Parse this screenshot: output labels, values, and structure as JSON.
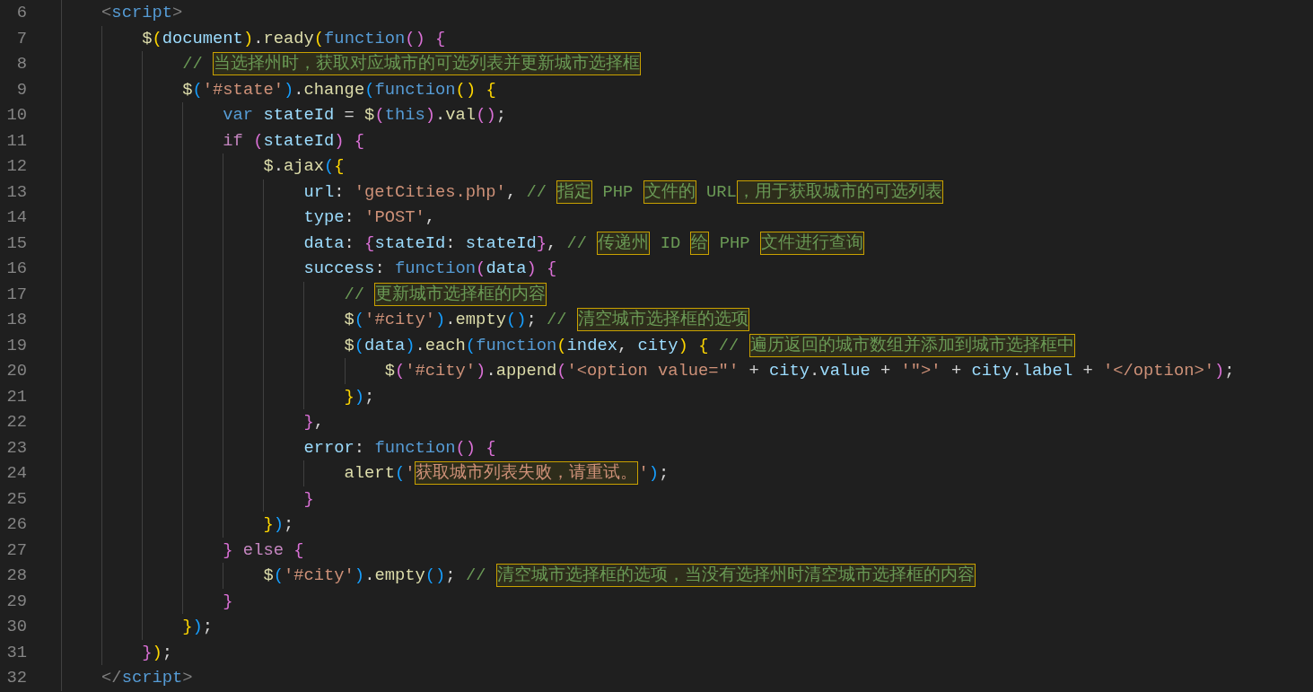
{
  "editor": {
    "lines": [
      {
        "number": "6",
        "tokens": [
          {
            "kind": "tag",
            "text": "    <"
          },
          {
            "kind": "tagname",
            "text": "script"
          },
          {
            "kind": "tag",
            "text": ">"
          }
        ]
      },
      {
        "number": "7",
        "tokens": [
          {
            "kind": "fn",
            "text": "        $"
          },
          {
            "kind": "b1",
            "text": "("
          },
          {
            "kind": "var",
            "text": "document"
          },
          {
            "kind": "b1",
            "text": ")"
          },
          {
            "kind": "plain",
            "text": "."
          },
          {
            "kind": "fn",
            "text": "ready"
          },
          {
            "kind": "b1",
            "text": "("
          },
          {
            "kind": "kw",
            "text": "function"
          },
          {
            "kind": "b2",
            "text": "() {"
          }
        ]
      },
      {
        "number": "8",
        "tokens": [
          {
            "kind": "comment",
            "text": "            // "
          },
          {
            "kind": "flagged-comment",
            "text": "当选择州时，获取对应城市的可选列表并更新城市选择框"
          }
        ]
      },
      {
        "number": "9",
        "tokens": [
          {
            "kind": "fn",
            "text": "            $"
          },
          {
            "kind": "b3",
            "text": "("
          },
          {
            "kind": "string",
            "text": "'#state'"
          },
          {
            "kind": "b3",
            "text": ")"
          },
          {
            "kind": "plain",
            "text": "."
          },
          {
            "kind": "fn",
            "text": "change"
          },
          {
            "kind": "b3",
            "text": "("
          },
          {
            "kind": "kw",
            "text": "function"
          },
          {
            "kind": "b1",
            "text": "() {"
          }
        ]
      },
      {
        "number": "10",
        "tokens": [
          {
            "kind": "kw",
            "text": "                var"
          },
          {
            "kind": "var",
            "text": " stateId"
          },
          {
            "kind": "plain",
            "text": " = "
          },
          {
            "kind": "fn",
            "text": "$"
          },
          {
            "kind": "b2",
            "text": "("
          },
          {
            "kind": "kw",
            "text": "this"
          },
          {
            "kind": "b2",
            "text": ")"
          },
          {
            "kind": "plain",
            "text": "."
          },
          {
            "kind": "fn",
            "text": "val"
          },
          {
            "kind": "b2",
            "text": "()"
          },
          {
            "kind": "plain",
            "text": ";"
          }
        ]
      },
      {
        "number": "11",
        "tokens": [
          {
            "kind": "ctl",
            "text": "                if"
          },
          {
            "kind": "b2",
            "text": " ("
          },
          {
            "kind": "var",
            "text": "stateId"
          },
          {
            "kind": "b2",
            "text": ") {"
          }
        ]
      },
      {
        "number": "12",
        "tokens": [
          {
            "kind": "fn",
            "text": "                    $"
          },
          {
            "kind": "plain",
            "text": "."
          },
          {
            "kind": "fn",
            "text": "ajax"
          },
          {
            "kind": "b3",
            "text": "("
          },
          {
            "kind": "b1",
            "text": "{"
          }
        ]
      },
      {
        "number": "13",
        "tokens": [
          {
            "kind": "var",
            "text": "                        url"
          },
          {
            "kind": "plain",
            "text": ": "
          },
          {
            "kind": "string",
            "text": "'getCities.php'"
          },
          {
            "kind": "plain",
            "text": ", "
          },
          {
            "kind": "comment",
            "text": "// "
          },
          {
            "kind": "flagged-comment",
            "text": "指定"
          },
          {
            "kind": "comment",
            "text": " PHP "
          },
          {
            "kind": "flagged-comment",
            "text": "文件的"
          },
          {
            "kind": "comment",
            "text": " URL"
          },
          {
            "kind": "flagged-comment",
            "text": "，用于获取城市的可选列表"
          }
        ]
      },
      {
        "number": "14",
        "tokens": [
          {
            "kind": "var",
            "text": "                        type"
          },
          {
            "kind": "plain",
            "text": ": "
          },
          {
            "kind": "string",
            "text": "'POST'"
          },
          {
            "kind": "plain",
            "text": ","
          }
        ]
      },
      {
        "number": "15",
        "tokens": [
          {
            "kind": "var",
            "text": "                        data"
          },
          {
            "kind": "plain",
            "text": ": "
          },
          {
            "kind": "b2",
            "text": "{"
          },
          {
            "kind": "var",
            "text": "stateId"
          },
          {
            "kind": "plain",
            "text": ": "
          },
          {
            "kind": "var",
            "text": "stateId"
          },
          {
            "kind": "b2",
            "text": "}"
          },
          {
            "kind": "plain",
            "text": ", "
          },
          {
            "kind": "comment",
            "text": "// "
          },
          {
            "kind": "flagged-comment",
            "text": "传递州"
          },
          {
            "kind": "comment",
            "text": " ID "
          },
          {
            "kind": "flagged-comment",
            "text": "给"
          },
          {
            "kind": "comment",
            "text": " PHP "
          },
          {
            "kind": "flagged-comment",
            "text": "文件进行查询"
          }
        ]
      },
      {
        "number": "16",
        "tokens": [
          {
            "kind": "var",
            "text": "                        success"
          },
          {
            "kind": "plain",
            "text": ": "
          },
          {
            "kind": "kw",
            "text": "function"
          },
          {
            "kind": "b2",
            "text": "("
          },
          {
            "kind": "var",
            "text": "data"
          },
          {
            "kind": "b2",
            "text": ") {"
          }
        ]
      },
      {
        "number": "17",
        "tokens": [
          {
            "kind": "comment",
            "text": "                            // "
          },
          {
            "kind": "flagged-comment",
            "text": "更新城市选择框的内容"
          }
        ]
      },
      {
        "number": "18",
        "tokens": [
          {
            "kind": "fn",
            "text": "                            $"
          },
          {
            "kind": "b3",
            "text": "("
          },
          {
            "kind": "string",
            "text": "'#city'"
          },
          {
            "kind": "b3",
            "text": ")"
          },
          {
            "kind": "plain",
            "text": "."
          },
          {
            "kind": "fn",
            "text": "empty"
          },
          {
            "kind": "b3",
            "text": "()"
          },
          {
            "kind": "plain",
            "text": "; "
          },
          {
            "kind": "comment",
            "text": "// "
          },
          {
            "kind": "flagged-comment",
            "text": "清空城市选择框的选项"
          }
        ]
      },
      {
        "number": "19",
        "tokens": [
          {
            "kind": "fn",
            "text": "                            $"
          },
          {
            "kind": "b3",
            "text": "("
          },
          {
            "kind": "var",
            "text": "data"
          },
          {
            "kind": "b3",
            "text": ")"
          },
          {
            "kind": "plain",
            "text": "."
          },
          {
            "kind": "fn",
            "text": "each"
          },
          {
            "kind": "b3",
            "text": "("
          },
          {
            "kind": "kw",
            "text": "function"
          },
          {
            "kind": "b1",
            "text": "("
          },
          {
            "kind": "var",
            "text": "index"
          },
          {
            "kind": "plain",
            "text": ", "
          },
          {
            "kind": "var",
            "text": "city"
          },
          {
            "kind": "b1",
            "text": ") {"
          },
          {
            "kind": "comment",
            "text": " // "
          },
          {
            "kind": "flagged-comment",
            "text": "遍历返回的城市数组并添加到城市选择框中"
          }
        ]
      },
      {
        "number": "20",
        "tokens": [
          {
            "kind": "fn",
            "text": "                                $"
          },
          {
            "kind": "b2",
            "text": "("
          },
          {
            "kind": "string",
            "text": "'#city'"
          },
          {
            "kind": "b2",
            "text": ")"
          },
          {
            "kind": "plain",
            "text": "."
          },
          {
            "kind": "fn",
            "text": "append"
          },
          {
            "kind": "b2",
            "text": "("
          },
          {
            "kind": "string",
            "text": "'<option value=\"'"
          },
          {
            "kind": "plain",
            "text": " + "
          },
          {
            "kind": "var",
            "text": "city"
          },
          {
            "kind": "plain",
            "text": "."
          },
          {
            "kind": "var",
            "text": "value"
          },
          {
            "kind": "plain",
            "text": " + "
          },
          {
            "kind": "string",
            "text": "'\">'"
          },
          {
            "kind": "plain",
            "text": " + "
          },
          {
            "kind": "var",
            "text": "city"
          },
          {
            "kind": "plain",
            "text": "."
          },
          {
            "kind": "var",
            "text": "label"
          },
          {
            "kind": "plain",
            "text": " + "
          },
          {
            "kind": "string",
            "text": "'</option>'"
          },
          {
            "kind": "b2",
            "text": ")"
          },
          {
            "kind": "plain",
            "text": ";"
          }
        ]
      },
      {
        "number": "21",
        "tokens": [
          {
            "kind": "b1",
            "text": "                            }"
          },
          {
            "kind": "b3",
            "text": ")"
          },
          {
            "kind": "plain",
            "text": ";"
          }
        ]
      },
      {
        "number": "22",
        "tokens": [
          {
            "kind": "b2",
            "text": "                        }"
          },
          {
            "kind": "plain",
            "text": ","
          }
        ]
      },
      {
        "number": "23",
        "tokens": [
          {
            "kind": "var",
            "text": "                        error"
          },
          {
            "kind": "plain",
            "text": ": "
          },
          {
            "kind": "kw",
            "text": "function"
          },
          {
            "kind": "b2",
            "text": "() {"
          }
        ]
      },
      {
        "number": "24",
        "tokens": [
          {
            "kind": "fn",
            "text": "                            alert"
          },
          {
            "kind": "b3",
            "text": "("
          },
          {
            "kind": "string",
            "text": "'"
          },
          {
            "kind": "flagged-string",
            "text": "获取城市列表失败，请重试。"
          },
          {
            "kind": "string",
            "text": "'"
          },
          {
            "kind": "b3",
            "text": ")"
          },
          {
            "kind": "plain",
            "text": ";"
          }
        ]
      },
      {
        "number": "25",
        "tokens": [
          {
            "kind": "b2",
            "text": "                        }"
          }
        ]
      },
      {
        "number": "26",
        "tokens": [
          {
            "kind": "b1",
            "text": "                    }"
          },
          {
            "kind": "b3",
            "text": ")"
          },
          {
            "kind": "plain",
            "text": ";"
          }
        ]
      },
      {
        "number": "27",
        "tokens": [
          {
            "kind": "b2",
            "text": "                }"
          },
          {
            "kind": "ctl",
            "text": " else"
          },
          {
            "kind": "b2",
            "text": " {"
          }
        ]
      },
      {
        "number": "28",
        "tokens": [
          {
            "kind": "fn",
            "text": "                    $"
          },
          {
            "kind": "b3",
            "text": "("
          },
          {
            "kind": "string",
            "text": "'#city'"
          },
          {
            "kind": "b3",
            "text": ")"
          },
          {
            "kind": "plain",
            "text": "."
          },
          {
            "kind": "fn",
            "text": "empty"
          },
          {
            "kind": "b3",
            "text": "()"
          },
          {
            "kind": "plain",
            "text": "; "
          },
          {
            "kind": "comment",
            "text": "// "
          },
          {
            "kind": "flagged-comment",
            "text": "清空城市选择框的选项，当没有选择州时清空城市选择框的内容"
          }
        ]
      },
      {
        "number": "29",
        "tokens": [
          {
            "kind": "b2",
            "text": "                }"
          }
        ]
      },
      {
        "number": "30",
        "tokens": [
          {
            "kind": "b1",
            "text": "            }"
          },
          {
            "kind": "b3",
            "text": ")"
          },
          {
            "kind": "plain",
            "text": ";"
          }
        ]
      },
      {
        "number": "31",
        "tokens": [
          {
            "kind": "b2",
            "text": "        }"
          },
          {
            "kind": "b1",
            "text": ")"
          },
          {
            "kind": "plain",
            "text": ";"
          }
        ]
      },
      {
        "number": "32",
        "tokens": [
          {
            "kind": "tag",
            "text": "    </"
          },
          {
            "kind": "tagname",
            "text": "script"
          },
          {
            "kind": "tag",
            "text": ">"
          }
        ]
      }
    ]
  }
}
